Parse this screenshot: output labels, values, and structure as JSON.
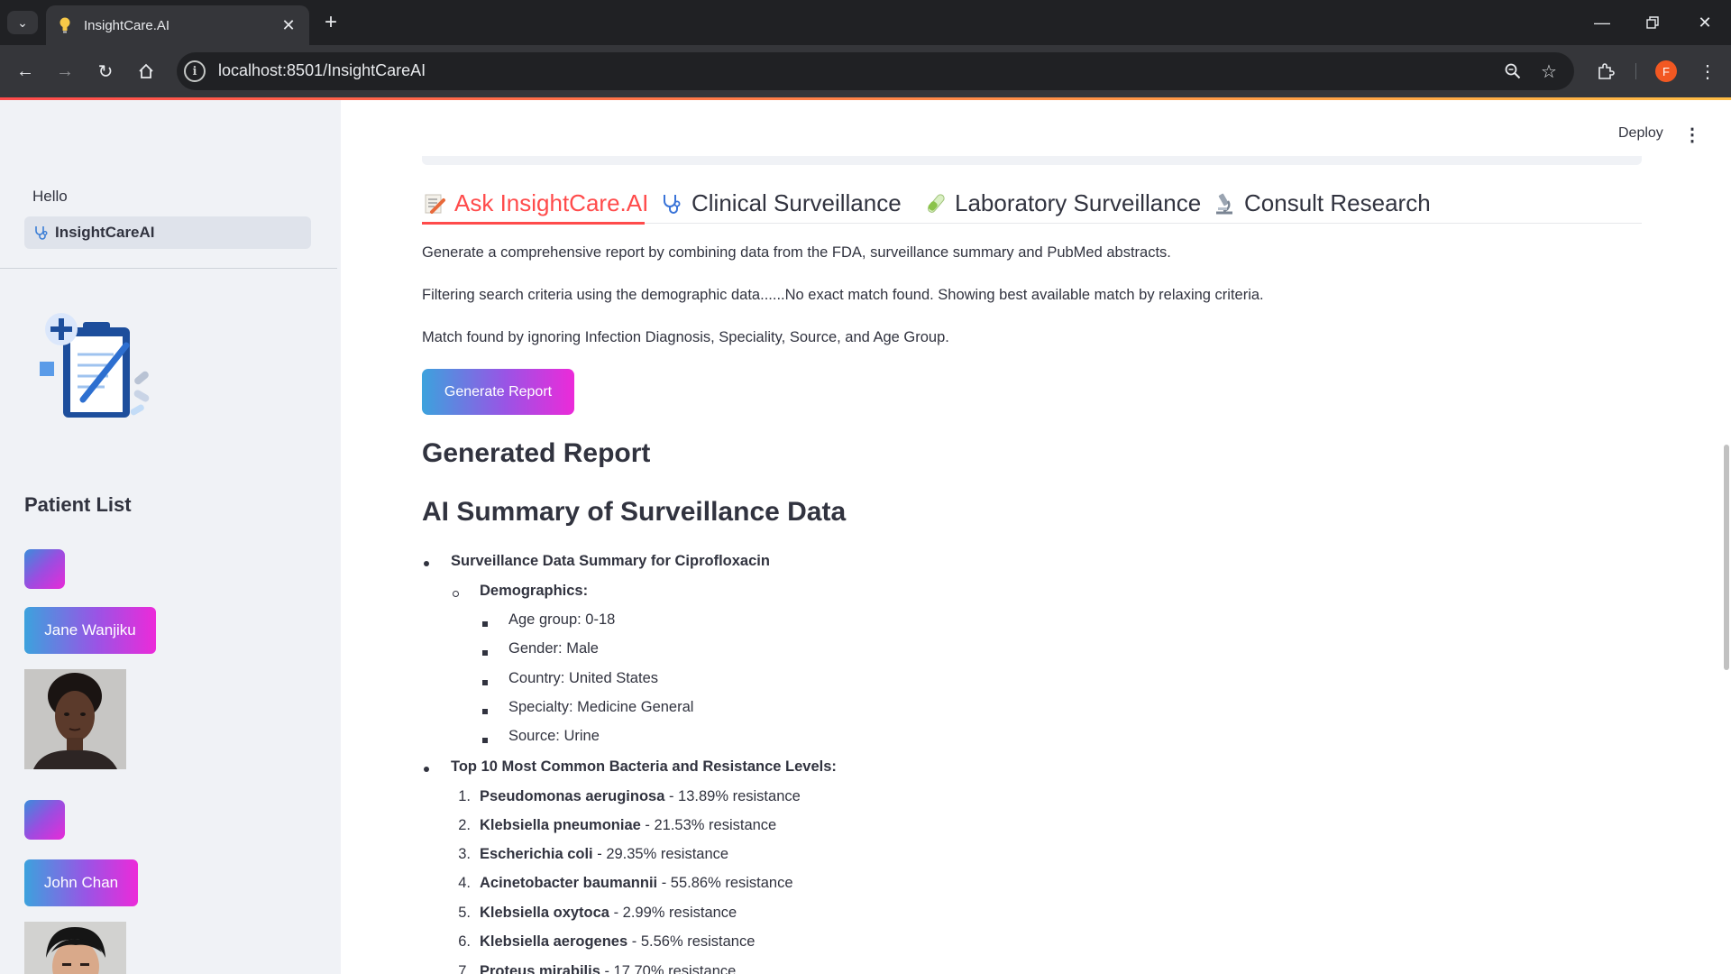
{
  "browser": {
    "tab_title": "InsightCare.AI",
    "url": "localhost:8501/InsightCareAI",
    "profile_initial": "F"
  },
  "sidebar": {
    "nav_hello": "Hello",
    "nav_active": "InsightCareAI",
    "patient_list_title": "Patient List",
    "patients": [
      {
        "name": "Jane Wanjiku"
      },
      {
        "name": "John Chan"
      }
    ]
  },
  "header": {
    "deploy_label": "Deploy"
  },
  "tabs": [
    {
      "label": "Ask InsightCare.AI",
      "icon": "memo-pencil-icon",
      "active": true
    },
    {
      "label": "Clinical Surveillance",
      "icon": "stethoscope-icon",
      "active": false
    },
    {
      "label": "Laboratory Surveillance",
      "icon": "test-tube-icon",
      "active": false
    },
    {
      "label": "Consult Research",
      "icon": "microscope-icon",
      "active": false
    }
  ],
  "content": {
    "intro": "Generate a comprehensive report by combining data from the FDA, surveillance summary and PubMed abstracts.",
    "filter_note": "Filtering search criteria using the demographic data......No exact match found. Showing best available match by relaxing criteria.",
    "match_note": "Match found by ignoring Infection Diagnosis, Speciality, Source, and Age Group.",
    "generate_button": "Generate Report",
    "generated_heading": "Generated Report",
    "ai_heading": "AI Summary of Surveillance Data",
    "summary_title": "Surveillance Data Summary for Ciprofloxacin",
    "demographics_title": "Demographics:",
    "demographics": [
      "Age group: 0-18",
      "Gender: Male",
      "Country: United States",
      "Specialty: Medicine General",
      "Source: Urine"
    ],
    "bacteria_title": "Top 10 Most Common Bacteria and Resistance Levels:",
    "bacteria": [
      {
        "num": "1.",
        "name": "Pseudomonas aeruginosa",
        "detail": " - 13.89% resistance"
      },
      {
        "num": "2.",
        "name": "Klebsiella pneumoniae",
        "detail": " - 21.53% resistance"
      },
      {
        "num": "3.",
        "name": "Escherichia coli",
        "detail": " - 29.35% resistance"
      },
      {
        "num": "4.",
        "name": "Acinetobacter baumannii",
        "detail": " - 55.86% resistance"
      },
      {
        "num": "5.",
        "name": "Klebsiella oxytoca",
        "detail": " - 2.99% resistance"
      },
      {
        "num": "6.",
        "name": "Klebsiella aerogenes",
        "detail": " - 5.56% resistance"
      },
      {
        "num": "7.",
        "name": "Proteus mirabilis",
        "detail": " - 17.70% resistance"
      }
    ]
  }
}
